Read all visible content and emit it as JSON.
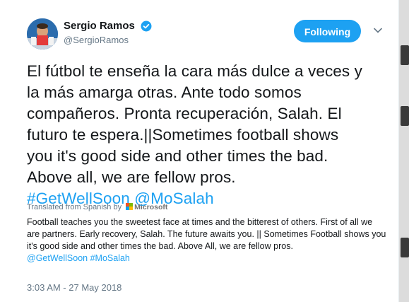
{
  "user": {
    "display_name": "Sergio Ramos",
    "handle": "@SergioRamos",
    "verified": true
  },
  "actions": {
    "follow_label": "Following"
  },
  "tweet": {
    "lines": [
      "El fútbol te enseña la cara más dulce a veces y",
      "la más amarga otras. Ante todo somos",
      "compañeros. Pronta recuperación, Salah. El",
      "futuro te espera.||Sometimes football shows",
      "you it's good side and other times the bad.",
      "Above all, we are fellow pros."
    ],
    "hashtag": "#GetWellSoon",
    "mention": "@MoSalah"
  },
  "translation": {
    "label": "Translated from Spanish by",
    "provider": "Microsoft",
    "lines": [
      "Football teaches you the sweetest face at times and the bitterest of others. First of all we",
      "are partners. Early recovery, Salah. The future awaits you. || Sometimes Football shows you",
      "it's good side and other times the bad. Above All, we are fellow pros."
    ],
    "mention": "@GetWellSoon",
    "hashtag": "#MoSalah"
  },
  "meta": {
    "timestamp": "3:03 AM - 27 May 2018"
  },
  "colors": {
    "accent": "#1da1f2",
    "text": "#14171a",
    "muted": "#657786"
  }
}
